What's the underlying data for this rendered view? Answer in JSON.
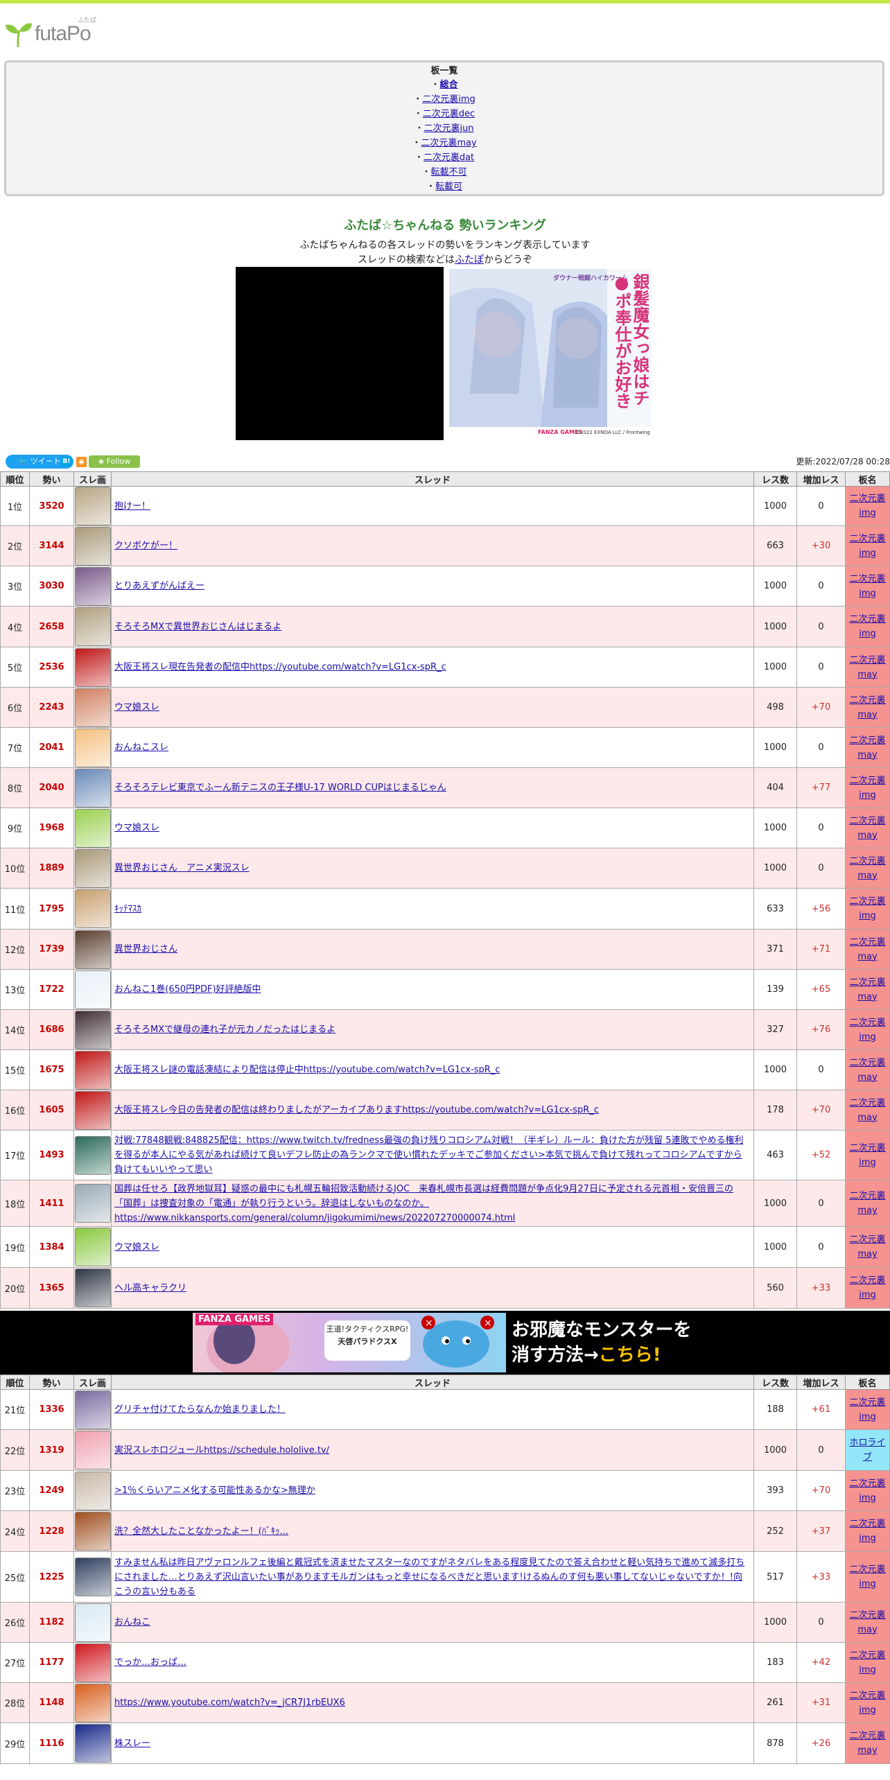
{
  "logo": {
    "name": "futaPo",
    "ruby": "ふたぽ"
  },
  "boards": {
    "heading": "板一覧",
    "items": [
      {
        "label": "総合",
        "current": true
      },
      {
        "label": "二次元裏img"
      },
      {
        "label": "二次元裏dec"
      },
      {
        "label": "二次元裏jun"
      },
      {
        "label": "二次元裏may"
      },
      {
        "label": "二次元裏dat"
      },
      {
        "label": "転載不可"
      },
      {
        "label": "転載可"
      }
    ]
  },
  "ranking": {
    "title": "ふたば☆ちゃんねる 勢いランキング",
    "desc1": "ふたばちゃんねるの各スレッドの勢いをランキング表示しています",
    "desc2_before": "スレッドの検索などは",
    "desc2_link": "ふたぽ",
    "desc2_after": "からどうぞ"
  },
  "ad_top": {
    "tagline": "ダウナー戦闘ハイカワーム",
    "title": "銀髪魔女っ娘はチ●ポ奉仕がお好き",
    "brand": "FANZA GAMES",
    "copyright": "©2022 EXNOA LLC / Frontwing"
  },
  "share": {
    "tweet": "ツイート",
    "hatena": "B!",
    "rss": "◉",
    "follow": "Follow"
  },
  "updated": "更新:2022/07/28 00:28",
  "columns": {
    "rank": "順位",
    "ikioi": "勢い",
    "thumb": "スレ画",
    "thread": "スレッド",
    "res": "レス数",
    "inc": "増加レス",
    "board": "板名"
  },
  "rows": [
    {
      "rank": "1位",
      "ikioi": "3520",
      "title": "抱けー！",
      "res": "1000",
      "inc": "0",
      "board": "二次元裏img",
      "color": "#b8a584"
    },
    {
      "rank": "2位",
      "ikioi": "3144",
      "title": "クソボケがー！",
      "res": "663",
      "inc": "+30",
      "board": "二次元裏img",
      "color": "#a89a7a"
    },
    {
      "rank": "3位",
      "ikioi": "3030",
      "title": "とりあえずがんばえー",
      "res": "1000",
      "inc": "0",
      "board": "二次元裏img",
      "color": "#7a5a8a"
    },
    {
      "rank": "4位",
      "ikioi": "2658",
      "title": "そろそろMXで異世界おじさんはじまるよ",
      "res": "1000",
      "inc": "0",
      "board": "二次元裏img",
      "color": "#b0a080"
    },
    {
      "rank": "5位",
      "ikioi": "2536",
      "title": "大阪王将スレ現在告発者の配信中https://youtube.com/watch?v=LG1cx-spR_c",
      "res": "1000",
      "inc": "0",
      "board": "二次元裏may",
      "color": "#c01818"
    },
    {
      "rank": "6位",
      "ikioi": "2243",
      "title": "ウマ娘スレ",
      "res": "498",
      "inc": "+70",
      "board": "二次元裏may",
      "color": "#d08060"
    },
    {
      "rank": "7位",
      "ikioi": "2041",
      "title": "おんねこスレ",
      "res": "1000",
      "inc": "0",
      "board": "二次元裏may",
      "color": "#f4c080"
    },
    {
      "rank": "8位",
      "ikioi": "2040",
      "title": "そろそろテレビ東京でふーん新テニスの王子様U-17 WORLD CUPはじまるじゃん",
      "res": "404",
      "inc": "+77",
      "board": "二次元裏img",
      "color": "#6a8ab8"
    },
    {
      "rank": "9位",
      "ikioi": "1968",
      "title": "ウマ娘スレ",
      "res": "1000",
      "inc": "0",
      "board": "二次元裏may",
      "color": "#9ad050"
    },
    {
      "rank": "10位",
      "ikioi": "1889",
      "title": "異世界おじさん　アニメ実況スレ",
      "res": "1000",
      "inc": "0",
      "board": "二次元裏may",
      "color": "#a89878"
    },
    {
      "rank": "11位",
      "ikioi": "1795",
      "title": "ｷｯﾃﾏｽｶ",
      "res": "633",
      "inc": "+56",
      "board": "二次元裏img",
      "color": "#c8a070"
    },
    {
      "rank": "12位",
      "ikioi": "1739",
      "title": "異世界おじさん",
      "res": "371",
      "inc": "+71",
      "board": "二次元裏may",
      "color": "#5a4030"
    },
    {
      "rank": "13位",
      "ikioi": "1722",
      "title": "おんねこ1巻(650円PDF)好評絶版中",
      "res": "139",
      "inc": "+65",
      "board": "二次元裏may",
      "color": "#e8f0f8"
    },
    {
      "rank": "14位",
      "ikioi": "1686",
      "title": "そろそろMXで継母の連れ子が元カノだったはじまるよ",
      "res": "327",
      "inc": "+76",
      "board": "二次元裏img",
      "color": "#403038"
    },
    {
      "rank": "15位",
      "ikioi": "1675",
      "title": "大阪王将スレ謎の電話凍結により配信は停止中https://youtube.com/watch?v=LG1cx-spR_c",
      "res": "1000",
      "inc": "0",
      "board": "二次元裏may",
      "color": "#c01818"
    },
    {
      "rank": "16位",
      "ikioi": "1605",
      "title": "大阪王将スレ今日の告発者の配信は終わりましたがアーカイブありますhttps://youtube.com/watch?v=LG1cx-spR_c",
      "res": "178",
      "inc": "+70",
      "board": "二次元裏may",
      "color": "#c01818"
    },
    {
      "rank": "17位",
      "ikioi": "1493",
      "title": "対戦:77848観戦:848825配信：https://www.twitch.tv/fredness最強の負け残りコロシアム対戦！（半ギレ）ルール：負けた方が残留 5連敗でやめる権利を得るが本人にやる気があれば続けて良いデフレ防止の為ランクマで使い慣れたデッキでご参加ください>本気で挑んで負けて残れってコロシアムですから負けてもいいやって思い",
      "res": "463",
      "inc": "+52",
      "board": "二次元裏img",
      "color": "#2a6a5a"
    },
    {
      "rank": "18位",
      "ikioi": "1411",
      "title": "国葬は任せろ【政界地獄耳】疑惑の最中にも札幌五輪招致活動続けるJOC　来春札幌市長選は経費問題が争点化9月27日に予定される元首相・安倍晋三の「国葬」は捜査対象の「電通」が執り行うという。辞退はしないものなのか。 https://www.nikkansports.com/general/column/jigokumimi/news/202207270000074.html",
      "res": "1000",
      "inc": "0",
      "board": "二次元裏may",
      "color": "#9aaab8"
    },
    {
      "rank": "19位",
      "ikioi": "1384",
      "title": "ウマ娘スレ",
      "res": "1000",
      "inc": "0",
      "board": "二次元裏may",
      "color": "#8ac840"
    },
    {
      "rank": "20位",
      "ikioi": "1365",
      "title": "ヘル高キャラクリ",
      "res": "560",
      "inc": "+33",
      "board": "二次元裏img",
      "color": "#303848"
    }
  ],
  "mid_ad": {
    "brand": "FANZA GAMES",
    "bubble1": "王道!タクティクスRPG!",
    "bubble2": "天啓パラドクスX",
    "copy1": "お邪魔なモンスターを",
    "copy2": "消す方法→",
    "copy3": "こちら!"
  },
  "rows2": [
    {
      "rank": "21位",
      "ikioi": "1336",
      "title": "グリチャ付けてたらなんか始まりました！",
      "res": "188",
      "inc": "+61",
      "board": "二次元裏img",
      "color": "#7a6aa0"
    },
    {
      "rank": "22位",
      "ikioi": "1319",
      "title": "実況スレホロジュールhttps://schedule.hololive.tv/",
      "res": "1000",
      "inc": "0",
      "board": "ホロライブ",
      "color": "#f0a0b0"
    },
    {
      "rank": "23位",
      "ikioi": "1249",
      "title": ">1％くらいアニメ化する可能性あるかな>無理か",
      "res": "393",
      "inc": "+70",
      "board": "二次元裏img",
      "color": "#c8b8a8"
    },
    {
      "rank": "24位",
      "ikioi": "1228",
      "title": "洗？全然大したことなかったよー！(ﾊﾞｷｯ...",
      "res": "252",
      "inc": "+37",
      "board": "二次元裏img",
      "color": "#a05020"
    },
    {
      "rank": "25位",
      "ikioi": "1225",
      "title": "すみません私は昨日アヴァロンルフェ後編と戴冠式を済ませたマスターなのですがネタバレをある程度見てたので答え合わせと軽い気持ちで進めて滅多打ちにされました…とりあえず沢山言いたい事がありますモルガンはもっと幸せになるべきだと思います!けるぬんのす何も悪い事してないじゃないですか！!向こうの言い分もある",
      "res": "517",
      "inc": "+33",
      "board": "二次元裏img",
      "color": "#304060"
    },
    {
      "rank": "26位",
      "ikioi": "1182",
      "title": "おんねこ",
      "res": "1000",
      "inc": "0",
      "board": "二次元裏may",
      "color": "#d8e8f4"
    },
    {
      "rank": "27位",
      "ikioi": "1177",
      "title": "でっか…おっぱ…",
      "res": "183",
      "inc": "+42",
      "board": "二次元裏img",
      "color": "#d01820"
    },
    {
      "rank": "28位",
      "ikioi": "1148",
      "title": "https://www.youtube.com/watch?v=_jCR7J1rbEUX6",
      "res": "261",
      "inc": "+31",
      "board": "二次元裏img",
      "color": "#d86020"
    },
    {
      "rank": "29位",
      "ikioi": "1116",
      "title": "株スレー",
      "res": "878",
      "inc": "+26",
      "board": "二次元裏may",
      "color": "#1a2a8a"
    }
  ]
}
